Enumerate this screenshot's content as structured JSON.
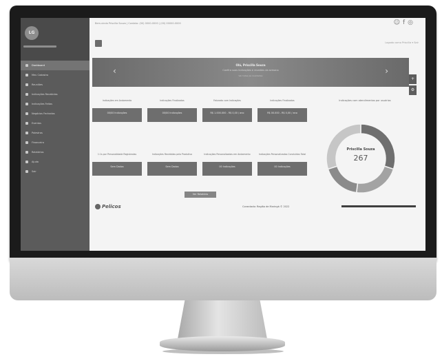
{
  "app": {
    "topline": "Bem-vinda Priscilla Souza | Contato: (00) 0000-0000 | (00) 00000-0000",
    "social_icons": [
      "chat-icon",
      "facebook-icon",
      "instagram-icon"
    ],
    "user_bar": "Logado como Priscilla  ▾  Sair"
  },
  "sidebar": {
    "avatar_initials": "LG",
    "items": [
      {
        "label": "Dashboard",
        "active": true
      },
      {
        "label": "Meu Cadastro",
        "active": false
      },
      {
        "label": "Reuniões",
        "active": false
      },
      {
        "label": "Indicações Recebidas",
        "active": false
      },
      {
        "label": "Indicações Feitas",
        "active": false
      },
      {
        "label": "Negócios Fechados",
        "active": false
      },
      {
        "label": "Eventos",
        "active": false
      },
      {
        "label": "Palestras",
        "active": false
      },
      {
        "label": "Financeiro",
        "active": false
      },
      {
        "label": "Relatórios",
        "active": false
      },
      {
        "label": "Ajuda",
        "active": false
      },
      {
        "label": "Sair",
        "active": false
      }
    ]
  },
  "banner": {
    "title": "Olá, Priscilla Souza",
    "subtitle": "Confira suas indicações e reuniões da semana",
    "link": "Ver todas as novidades",
    "prev_arrow": "‹",
    "next_arrow": "›"
  },
  "side_tabs": [
    "+",
    "⚙"
  ],
  "cards_row1": [
    {
      "label": "Indicações em Andamento",
      "value": "00/00 Indicações"
    },
    {
      "label": "Indicações Finalizadas",
      "value": "00/00 Indicações"
    },
    {
      "label": "Faturado com Indicações",
      "value": "R$ 1.000.000 - R$ 0,00 / ano"
    },
    {
      "label": "Indicações Finalizadas",
      "value": "R$ 00.000 - R$ 0,00 / ano"
    }
  ],
  "cards_row2": [
    {
      "label": "1:1s por Personalidade Registradas",
      "value": "Sem Dados"
    },
    {
      "label": "Indicações Recebidas pelo Produtivo",
      "value": "Sem Dados"
    },
    {
      "label": "Indicações Personalizadas em Andamento",
      "value": "00 Indicações"
    },
    {
      "label": "Indicações Personalizadas Concluídas Total",
      "value": "00 Indicações"
    }
  ],
  "donut": {
    "title": "Indicações com atendimentos por usuários",
    "name": "Priscilla Souza",
    "count": "267",
    "segments": [
      {
        "fraction": 0.3,
        "color": "#6f6f6f"
      },
      {
        "fraction": 0.22,
        "color": "#a3a3a3"
      },
      {
        "fraction": 0.18,
        "color": "#8b8b8b"
      },
      {
        "fraction": 0.3,
        "color": "#c6c6c6"
      }
    ]
  },
  "center_button": "Ver Relatório",
  "logo_text": "Pelicos",
  "footer": "Conectado: Região de Maringá © 2022",
  "progress_fraction": 1.0
}
